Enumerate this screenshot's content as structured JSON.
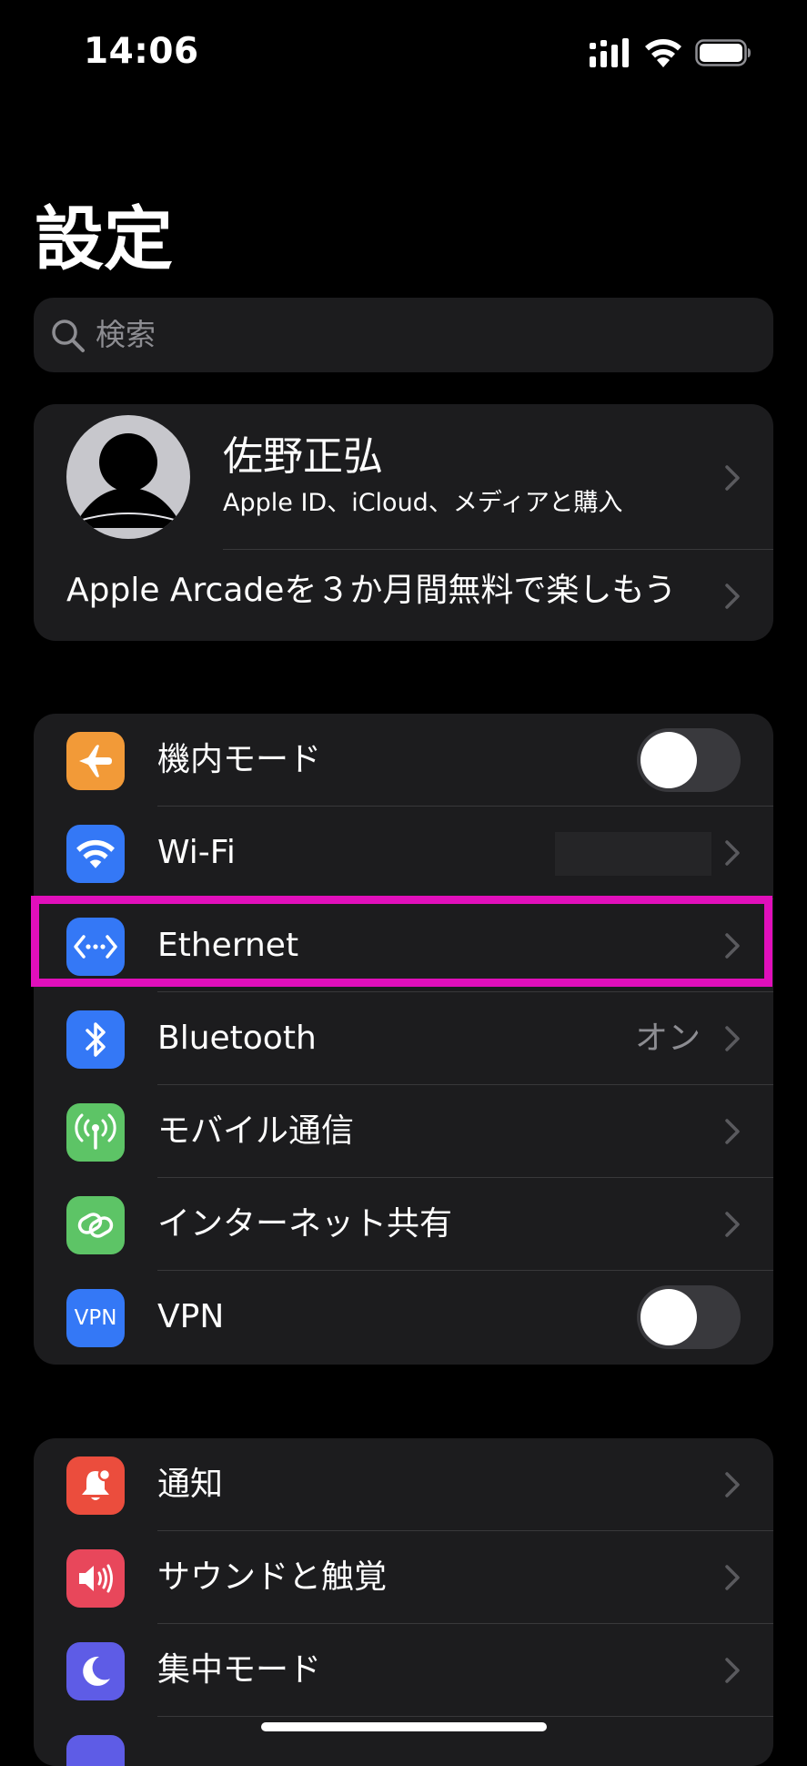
{
  "status_bar": {
    "time": "14:06"
  },
  "title": "設定",
  "search": {
    "placeholder": "検索"
  },
  "profile": {
    "name": "佐野正弘",
    "subtitle": "Apple ID、iCloud、メディアと購入",
    "promo": "Apple Arcadeを３か月間無料で楽しもう"
  },
  "network_group": [
    {
      "label": "機内モード",
      "icon": "airplane-icon",
      "color": "#f29a38",
      "control": "toggle",
      "toggle_on": false
    },
    {
      "label": "Wi-Fi",
      "icon": "wifi-icon",
      "color": "#3478f6",
      "control": "chevron",
      "value": ""
    },
    {
      "label": "Ethernet",
      "icon": "ethernet-icon",
      "color": "#3478f6",
      "control": "chevron",
      "value": ""
    },
    {
      "label": "Bluetooth",
      "icon": "bluetooth-icon",
      "color": "#3478f6",
      "control": "chevron",
      "value": "オン"
    },
    {
      "label": "モバイル通信",
      "icon": "antenna-icon",
      "color": "#5dc466",
      "control": "chevron",
      "value": ""
    },
    {
      "label": "インターネット共有",
      "icon": "hotspot-icon",
      "color": "#5dc466",
      "control": "chevron",
      "value": ""
    },
    {
      "label": "VPN",
      "icon": "vpn-icon",
      "color": "#3478f6",
      "control": "toggle",
      "toggle_on": false
    }
  ],
  "notifications_group": [
    {
      "label": "通知",
      "icon": "bell-icon",
      "color": "#eb4d3d"
    },
    {
      "label": "サウンドと触覚",
      "icon": "speaker-icon",
      "color": "#e8475b"
    },
    {
      "label": "集中モード",
      "icon": "moon-icon",
      "color": "#5e5ce6"
    }
  ],
  "vpn_icon_text": "VPN",
  "highlight_color": "#e10fbb"
}
